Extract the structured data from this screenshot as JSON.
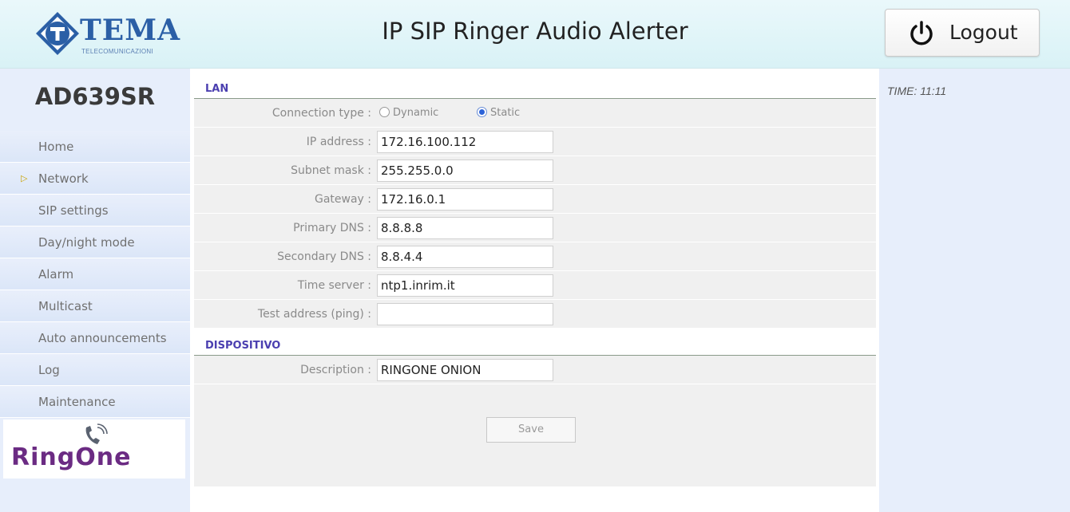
{
  "header": {
    "logo_brand": "TEMA",
    "logo_sub": "TELECOMUNICAZIONI",
    "title": "IP SIP Ringer Audio Alerter",
    "logout_label": "Logout"
  },
  "sidebar": {
    "model": "AD639SR",
    "active_item": "Network",
    "items": [
      {
        "label": "Home"
      },
      {
        "label": "Network"
      },
      {
        "label": "SIP settings"
      },
      {
        "label": "Day/night mode"
      },
      {
        "label": "Alarm"
      },
      {
        "label": "Multicast"
      },
      {
        "label": "Auto announcements"
      },
      {
        "label": "Log"
      },
      {
        "label": "Maintenance"
      }
    ],
    "bottom_logo_text": "RingOne"
  },
  "lan": {
    "title": "LAN",
    "connection_type": {
      "label": "Connection type :",
      "options": [
        "Dynamic",
        "Static"
      ],
      "selected": "Static"
    },
    "fields": [
      {
        "label": "IP address :",
        "value": "172.16.100.112"
      },
      {
        "label": "Subnet mask :",
        "value": "255.255.0.0"
      },
      {
        "label": "Gateway :",
        "value": "172.16.0.1"
      },
      {
        "label": "Primary DNS :",
        "value": "8.8.8.8"
      },
      {
        "label": "Secondary DNS :",
        "value": "8.8.4.4"
      },
      {
        "label": "Time server :",
        "value": "ntp1.inrim.it"
      },
      {
        "label": "Test address (ping) :",
        "value": ""
      }
    ]
  },
  "dispositivo": {
    "title": "DISPOSITIVO",
    "fields": [
      {
        "label": "Description :",
        "value": "RINGONE ONION"
      }
    ]
  },
  "save_label": "Save",
  "time_label": "TIME: 11:11",
  "colors": {
    "section_title": "#4b3fb0",
    "sidebar_bg": "#e7eefb",
    "radio_selected": "#2b62d8",
    "active_arrow": "#c9a300"
  },
  "icons": {
    "logo": "tema-diamond-logo-icon",
    "logout": "power-icon",
    "active": "triangle-right-icon",
    "ringone": "phone-ringing-icon"
  }
}
